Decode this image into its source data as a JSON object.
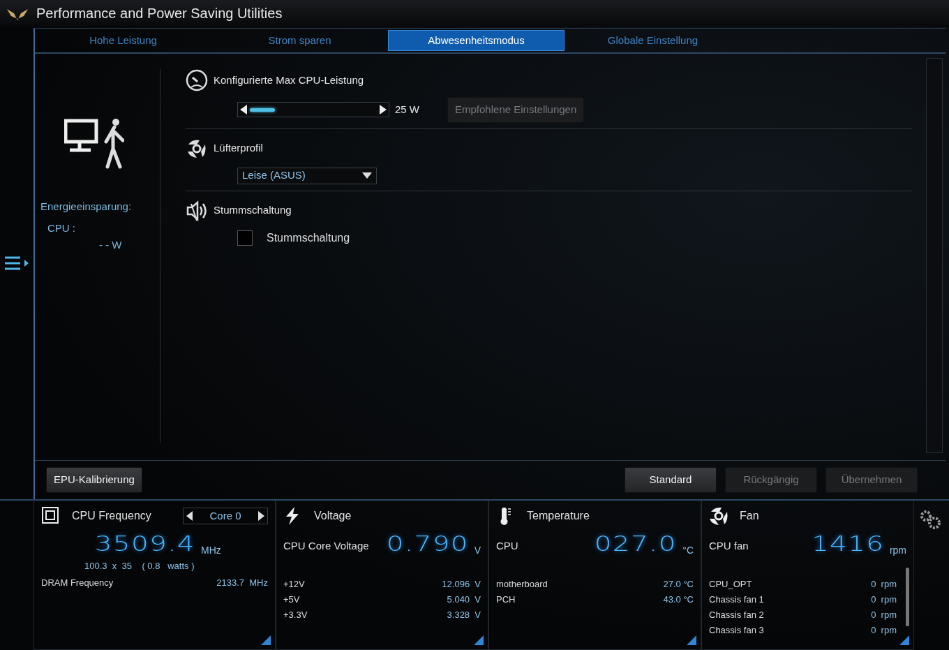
{
  "window": {
    "title": "Performance and Power Saving Utilities"
  },
  "tabs": [
    {
      "label": "Hohe Leistung",
      "selected": false
    },
    {
      "label": "Strom sparen",
      "selected": false
    },
    {
      "label": "Abwesenheitsmodus",
      "selected": true
    },
    {
      "label": "Globale Einstellung",
      "selected": false
    }
  ],
  "summary": {
    "heading": "Energieeinsparung:",
    "label": "CPU :",
    "value": "- - W"
  },
  "sections": [
    {
      "kind": "slider",
      "title": "Konfigurierte Max CPU-Leistung",
      "level": 0.2,
      "reading": "25 W",
      "button": {
        "label": "Empfohlene Einstellungen",
        "disabled": true
      }
    },
    {
      "kind": "dropdown",
      "title": "Lüfterprofil",
      "value": "Leise (ASUS)"
    },
    {
      "kind": "checkbox",
      "title": "Stummschaltung",
      "label": "Stummschaltung",
      "checked": false
    }
  ],
  "left_button": {
    "label": "EPU-Kalibrierung",
    "disabled": false
  },
  "buttons": [
    {
      "label": "Standard",
      "disabled": false
    },
    {
      "label": "Rückgängig",
      "disabled": true
    },
    {
      "label": "Übernehmen",
      "disabled": true
    }
  ],
  "monitor": [
    {
      "kind": "frequency",
      "title": "CPU Frequency",
      "selector": "Core 0",
      "value": "3509.4",
      "unit": "MHz",
      "detail": "100.3  x  35    ( 0.8   watts )",
      "rows": [
        {
          "label": "DRAM Frequency",
          "value": "2133.7  MHz"
        }
      ]
    },
    {
      "kind": "voltage",
      "title": "Voltage",
      "main_label": "CPU Core Voltage",
      "value": "0.790",
      "unit": "V",
      "rows": [
        {
          "label": "+12V",
          "value": "12.096  V"
        },
        {
          "label": "+5V",
          "value": "5.040  V"
        },
        {
          "label": "+3.3V",
          "value": "3.328  V"
        }
      ]
    },
    {
      "kind": "temperature",
      "title": "Temperature",
      "main_label": "CPU",
      "value": "027.0",
      "unit": "°C",
      "rows": [
        {
          "label": "motherboard",
          "value": "27.0 °C"
        },
        {
          "label": "PCH",
          "value": "43.0 °C"
        }
      ]
    },
    {
      "kind": "fan",
      "title": "Fan",
      "main_label": "CPU fan",
      "value": "1416",
      "unit": "rpm",
      "rows": [
        {
          "label": "CPU_OPT",
          "value": "0  rpm"
        },
        {
          "label": "Chassis fan 1",
          "value": "0  rpm"
        },
        {
          "label": "Chassis fan 2",
          "value": "0  rpm"
        },
        {
          "label": "Chassis fan 3",
          "value": "0  rpm"
        }
      ]
    }
  ]
}
